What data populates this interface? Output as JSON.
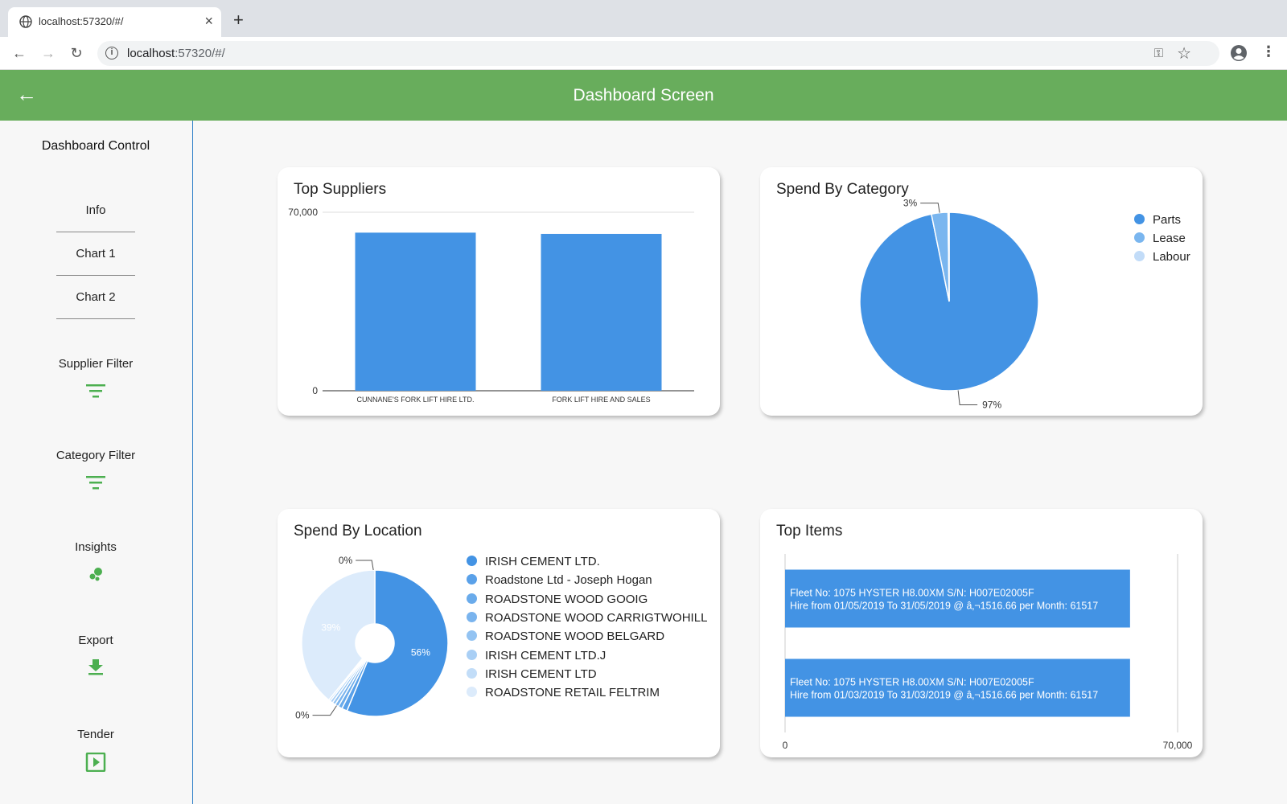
{
  "browser": {
    "tab_title": "localhost:57320/#/",
    "url_host": "localhost",
    "url_rest": ":57320/#/"
  },
  "appbar": {
    "title": "Dashboard Screen"
  },
  "sidebar": {
    "title": "Dashboard Control",
    "links": [
      "Info",
      "Chart 1",
      "Chart 2"
    ],
    "actions": [
      {
        "label": "Supplier Filter",
        "icon": "filter-icon"
      },
      {
        "label": "Category Filter",
        "icon": "filter-icon"
      },
      {
        "label": "Insights",
        "icon": "bubbles-icon"
      },
      {
        "label": "Export",
        "icon": "download-icon"
      },
      {
        "label": "Tender",
        "icon": "play-box-icon"
      }
    ],
    "accent_color": "#4caf50"
  },
  "cards": {
    "top_suppliers": "Top Suppliers",
    "spend_by_category": "Spend By Category",
    "spend_by_location": "Spend By Location",
    "top_items": "Top Items"
  },
  "chart_data": [
    {
      "type": "bar",
      "title": "Top Suppliers",
      "categories": [
        "CUNNANE'S FORK LIFT HIRE LTD.",
        "FORK LIFT HIRE AND SALES"
      ],
      "values": [
        62000,
        61500
      ],
      "ylim": [
        0,
        70000
      ],
      "ytick_labels": [
        "0",
        "70,000"
      ],
      "color": "#4393e4"
    },
    {
      "type": "pie",
      "title": "Spend By Category",
      "labels": [
        "Parts",
        "Lease",
        "Labour"
      ],
      "values": [
        97,
        3,
        0.2
      ],
      "data_labels": [
        "97%",
        "3%"
      ],
      "colors": [
        "#4393e4",
        "#7ab6ef",
        "#c2dcf8"
      ],
      "legend": "right"
    },
    {
      "type": "pie",
      "title": "Spend By Location",
      "labels": [
        "IRISH CEMENT LTD.",
        "Roadstone Ltd - Joseph Hogan",
        "ROADSTONE WOOD GOOIG",
        "ROADSTONE WOOD CARRIGTWOHILL",
        "ROADSTONE WOOD BELGARD",
        "IRISH CEMENT LTD.J",
        "IRISH CEMENT LTD",
        "ROADSTONE RETAIL FELTRIM"
      ],
      "values": [
        56,
        1.2,
        0.9,
        0.8,
        0.7,
        0.6,
        0.4,
        39
      ],
      "data_labels": [
        "56%",
        "39%",
        "0%",
        "0%"
      ],
      "colors": [
        "#4393e4",
        "#5aa1e9",
        "#6aabeb",
        "#7ab4ee",
        "#93c3f2",
        "#a9cff5",
        "#c2ddf8",
        "#dcebfb"
      ],
      "donut": true,
      "legend": "right"
    },
    {
      "type": "bar",
      "orientation": "horizontal",
      "title": "Top Items",
      "categories": [
        [
          "Fleet No: 1075 HYSTER H8.00XM S/N: H007E02005F",
          "Hire from 01/05/2019 To 31/05/2019 @ â‚¬1516.66 per Month: 61517"
        ],
        [
          "Fleet No: 1075 HYSTER H8.00XM S/N: H007E02005F",
          "Hire from 01/03/2019 To 31/03/2019 @ â‚¬1516.66 per Month: 61517"
        ]
      ],
      "values": [
        61517,
        61517
      ],
      "xlim": [
        0,
        70000
      ],
      "xtick_labels": [
        "0",
        "70,000"
      ],
      "color": "#4393e4"
    }
  ]
}
